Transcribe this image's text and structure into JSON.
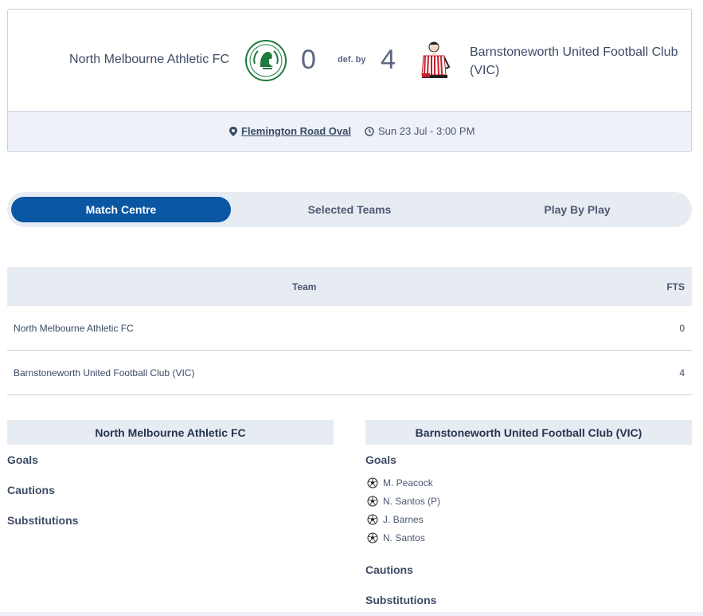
{
  "match": {
    "home_name": "North Melbourne Athletic FC",
    "home_score": "0",
    "result_text": "def. by",
    "away_score": "4",
    "away_name": "Barnstoneworth United Football Club (VIC)",
    "venue": "Flemington Road Oval",
    "datetime": "Sun 23 Jul - 3:00 PM",
    "home_logo_icon": "spartan-helmet-crest-icon",
    "away_logo_icon": "striped-shirt-player-crest-icon"
  },
  "tabs": [
    {
      "label": "Match Centre",
      "active": true
    },
    {
      "label": "Selected Teams",
      "active": false
    },
    {
      "label": "Play By Play",
      "active": false
    }
  ],
  "score_table": {
    "headers": {
      "team": "Team",
      "fts": "FTS"
    },
    "rows": [
      {
        "team": "North Melbourne Athletic FC",
        "fts": "0"
      },
      {
        "team": "Barnstoneworth United Football Club (VIC)",
        "fts": "4"
      }
    ]
  },
  "home_detail": {
    "title": "North Melbourne Athletic FC",
    "goals_label": "Goals",
    "cautions_label": "Cautions",
    "subs_label": "Substitutions"
  },
  "away_detail": {
    "title": "Barnstoneworth United Football Club (VIC)",
    "goals_label": "Goals",
    "goals": [
      "M. Peacock",
      "N. Santos (P)",
      "J. Barnes",
      "N. Santos"
    ],
    "cautions_label": "Cautions",
    "subs_label": "Substitutions"
  },
  "colors": {
    "accent": "#0a56a3",
    "panel": "#e7ecf3",
    "text": "#3a4a66",
    "border": "#c9d1dc"
  }
}
